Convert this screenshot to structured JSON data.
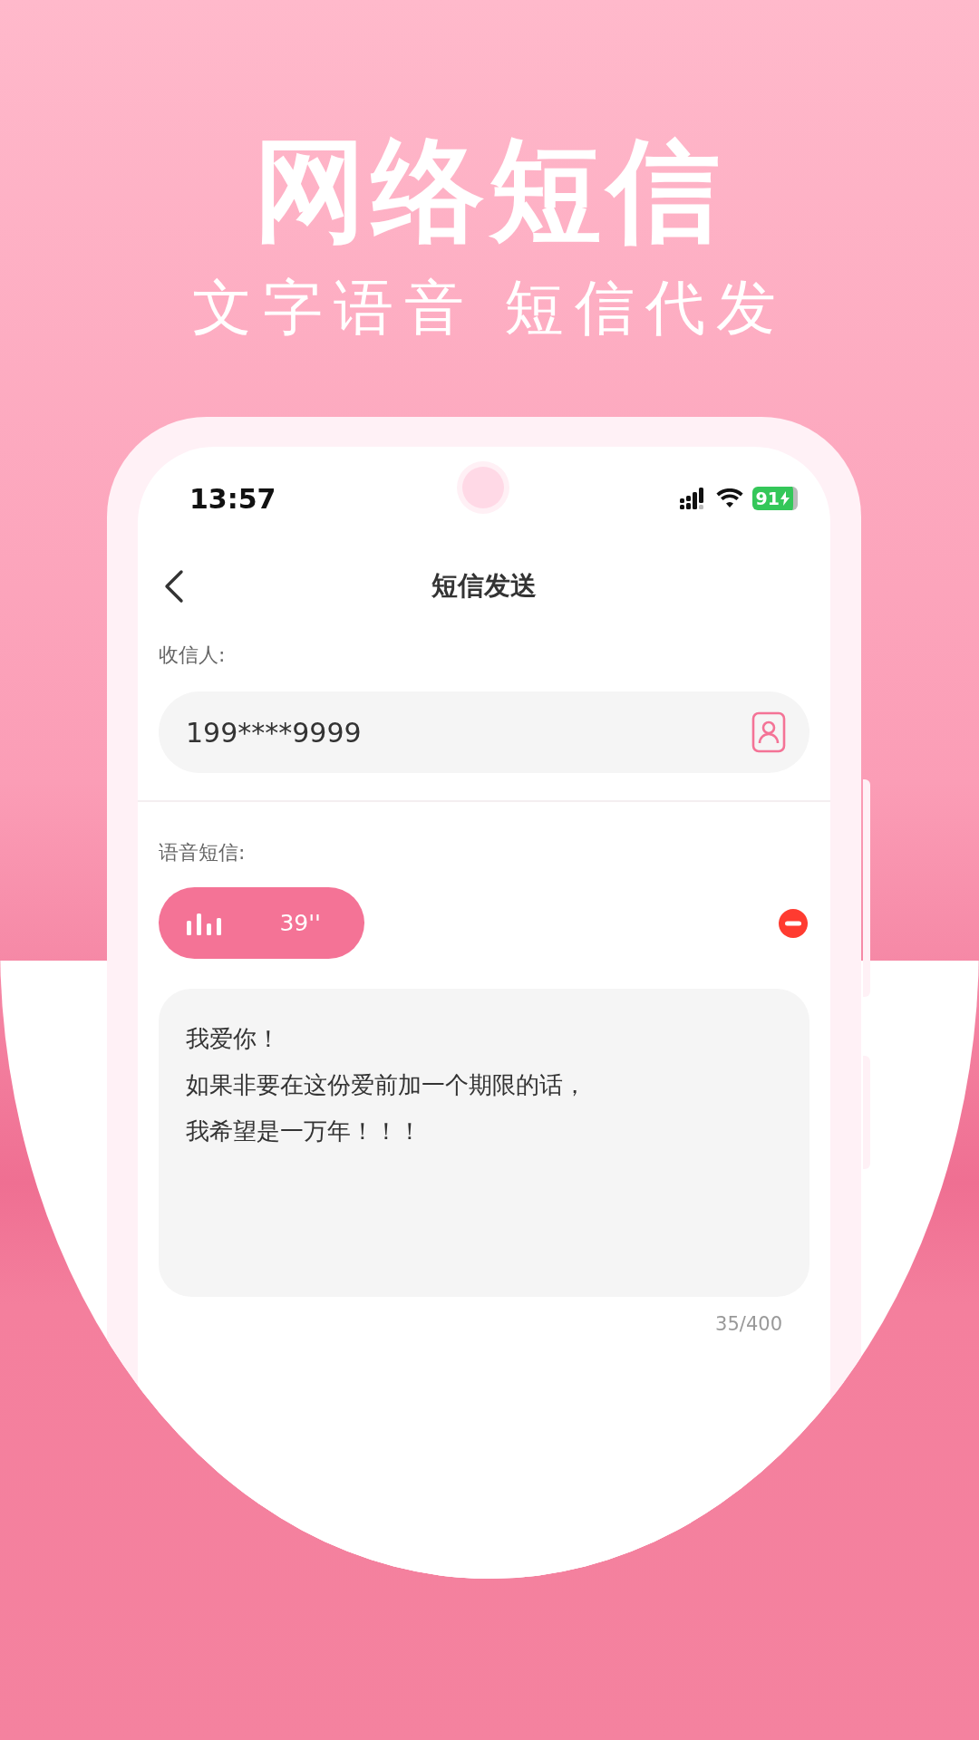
{
  "banner": {
    "title": "网络短信",
    "subtitle": "文字语音 短信代发"
  },
  "status_bar": {
    "time": "13:57",
    "battery": "91",
    "charging": true
  },
  "nav": {
    "title": "短信发送"
  },
  "recipient": {
    "label": "收信人:",
    "value": "199****9999"
  },
  "voice": {
    "label": "语音短信:",
    "duration": "39''"
  },
  "message": {
    "lines": [
      "我爱你！",
      "如果非要在这份爱前加一个期限的话，",
      "我希望是一万年！！！"
    ],
    "counter": "35/400"
  }
}
